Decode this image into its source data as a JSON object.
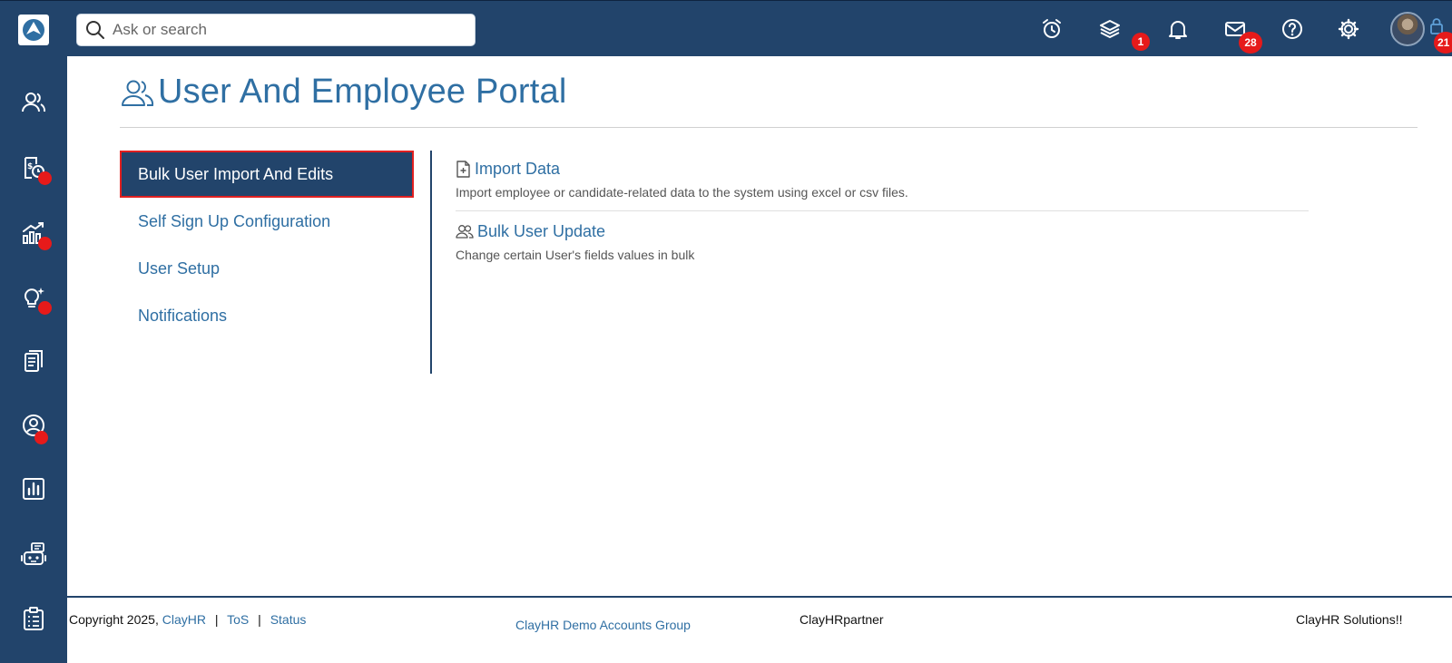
{
  "topbar": {
    "search_placeholder": "Ask or search",
    "badges": {
      "layers": "1",
      "mail": "28",
      "lock": "21"
    }
  },
  "page": {
    "title": "User And Employee Portal"
  },
  "menu": {
    "items": [
      {
        "label": "Bulk User Import And Edits",
        "active": true
      },
      {
        "label": "Self Sign Up Configuration",
        "active": false
      },
      {
        "label": "User Setup",
        "active": false
      },
      {
        "label": "Notifications",
        "active": false
      }
    ]
  },
  "options": [
    {
      "title": "Import Data",
      "description": "Import employee or candidate-related data to the system using excel or csv files.",
      "icon": "file-plus-icon"
    },
    {
      "title": "Bulk User Update",
      "description": "Change certain User's fields values in bulk",
      "icon": "users-icon"
    }
  ],
  "footer": {
    "copyright": "Copyright 2025,",
    "brand_link": "ClayHR",
    "sep": "|",
    "tos": "ToS",
    "status": "Status",
    "group": "ClayHR Demo Accounts Group",
    "partner": "ClayHRpartner",
    "solutions": "ClayHR Solutions!!"
  },
  "colors": {
    "navy": "#22446b",
    "link": "#2f6fa3",
    "badge": "#e61a1a",
    "active_border": "#e02020"
  }
}
